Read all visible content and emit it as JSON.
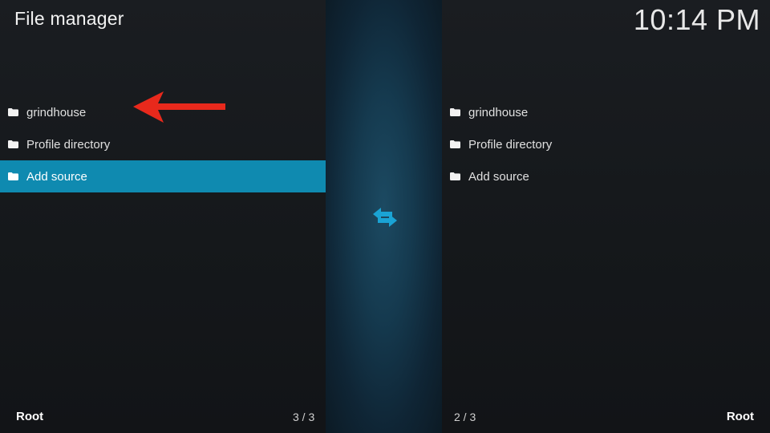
{
  "header": {
    "title": "File manager",
    "clock": "10:14 PM"
  },
  "left_pane": {
    "items": [
      {
        "label": "grindhouse",
        "icon": "folder-icon",
        "selected": false
      },
      {
        "label": "Profile directory",
        "icon": "folder-icon",
        "selected": false
      },
      {
        "label": "Add source",
        "icon": "folder-icon",
        "selected": true
      }
    ],
    "path": "Root",
    "count": "3 / 3"
  },
  "right_pane": {
    "items": [
      {
        "label": "grindhouse",
        "icon": "folder-icon"
      },
      {
        "label": "Profile directory",
        "icon": "folder-icon"
      },
      {
        "label": "Add source",
        "icon": "folder-icon"
      }
    ],
    "path": "Root",
    "count": "2 / 3"
  },
  "center": {
    "icon": "swap-arrows-icon"
  },
  "annotation": {
    "icon": "red-arrow-icon",
    "color": "#e8291c"
  },
  "colors": {
    "selection": "#0f8ab0",
    "swap_icon": "#1aa3d4"
  }
}
